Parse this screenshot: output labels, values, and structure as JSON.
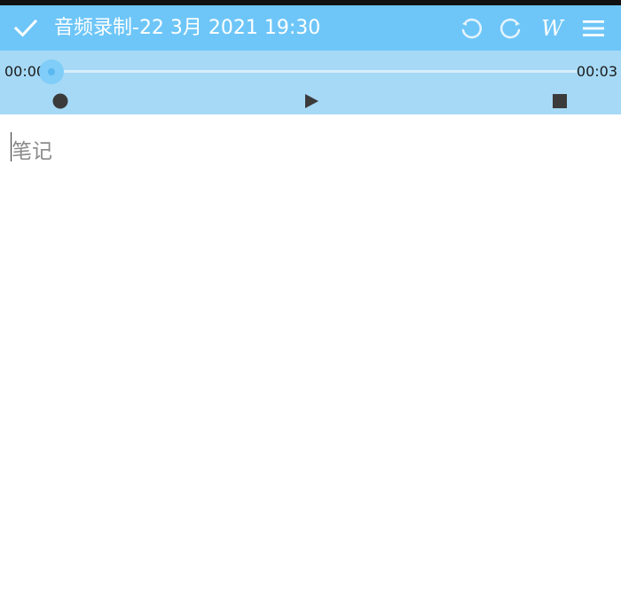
{
  "toolbar": {
    "title": "音频录制-22 3月 2021 19:30",
    "background_color": "#6ec6f8",
    "icons": [
      "check-icon",
      "undo-icon",
      "redo-icon",
      "wiki-link-icon",
      "menu-icon"
    ],
    "wiki_glyph": "W"
  },
  "player": {
    "background_color": "#a6d9f5",
    "current_time": "00:00",
    "total_time": "00:03",
    "progress": 0,
    "controls": [
      "record-icon",
      "play-icon",
      "stop-icon"
    ]
  },
  "note": {
    "placeholder": "笔记",
    "value": ""
  }
}
